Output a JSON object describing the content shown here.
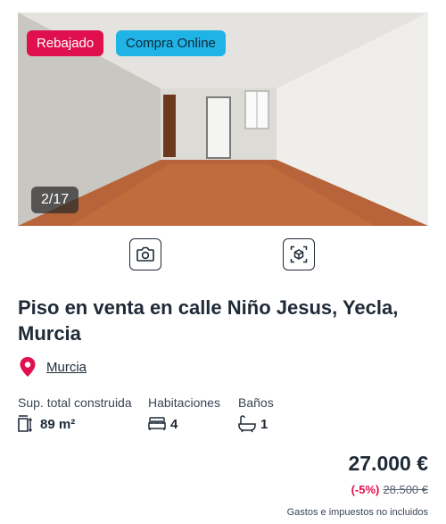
{
  "listing": {
    "badges": {
      "sale": "Rebajado",
      "online": "Compra Online"
    },
    "photo_counter": "2/17",
    "title": "Piso en venta en calle Niño Jesus, Yecla, Murcia",
    "location": "Murcia",
    "features": [
      {
        "label": "Sup. total construida",
        "value": "89 m²",
        "icon": "area-icon"
      },
      {
        "label": "Habitaciones",
        "value": "4",
        "icon": "bed-icon"
      },
      {
        "label": "Baños",
        "value": "1",
        "icon": "bathtub-icon"
      }
    ],
    "price": "27.000 €",
    "discount": "(-5%)",
    "old_price": "28.500 €",
    "taxes_note": "Gastos e impuestos no incluidos"
  },
  "colors": {
    "brand": "#e0104e",
    "online": "#20b3e6",
    "text": "#1f2a37"
  }
}
